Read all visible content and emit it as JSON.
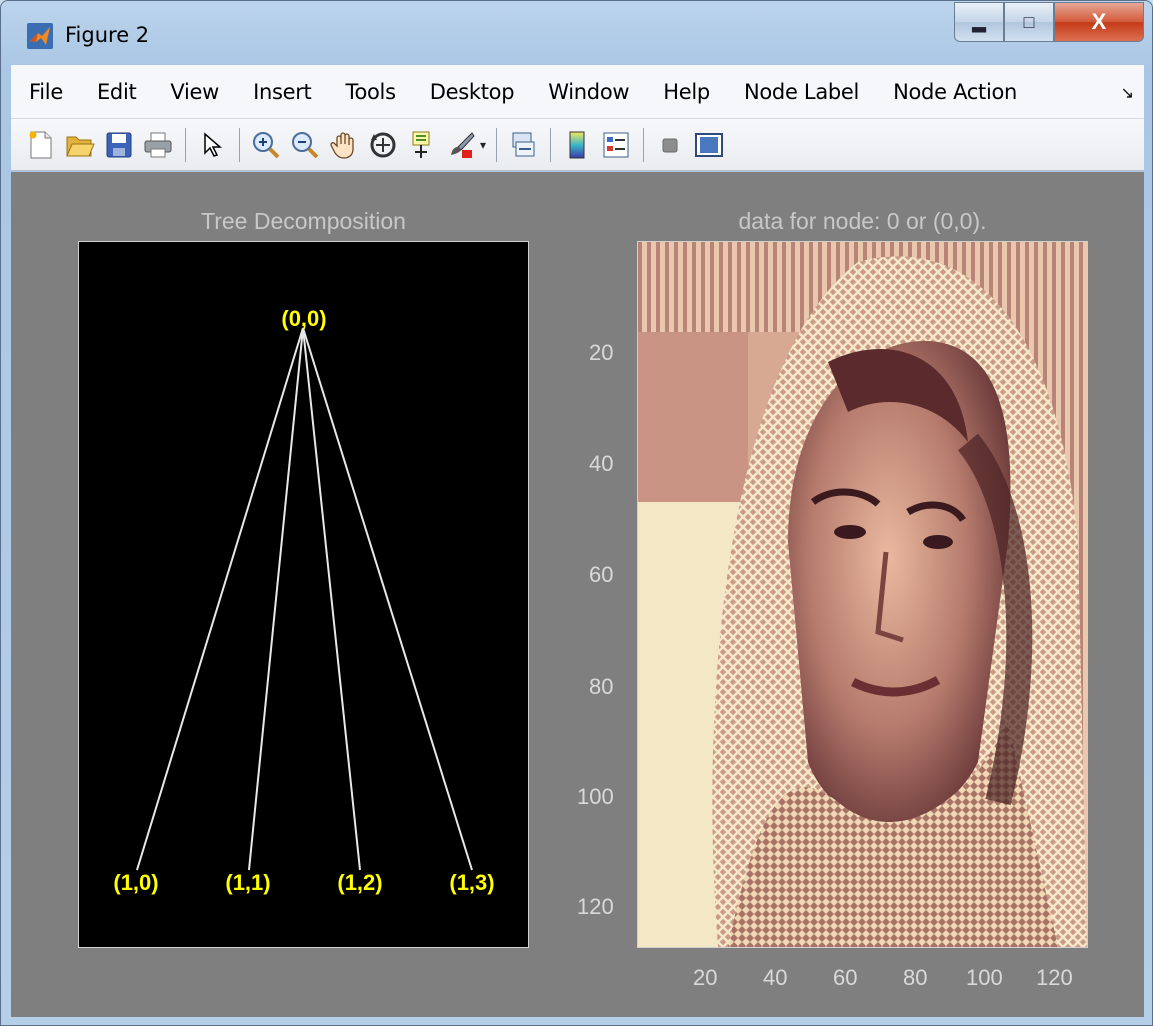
{
  "window": {
    "title": "Figure 2"
  },
  "menu": [
    "File",
    "Edit",
    "View",
    "Insert",
    "Tools",
    "Desktop",
    "Window",
    "Help",
    "Node Label",
    "Node Action"
  ],
  "toolbar_icons": [
    "new-figure-icon",
    "open-file-icon",
    "save-icon",
    "print-icon",
    "edit-plot-arrow-icon",
    "zoom-in-icon",
    "zoom-out-icon",
    "pan-hand-icon",
    "rotate-3d-icon",
    "data-cursor-icon",
    "brush-icon",
    "link-plot-icon",
    "colorbar-icon",
    "legend-icon",
    "hide-plot-tools-icon",
    "show-plot-tools-icon"
  ],
  "tree_panel": {
    "title": "Tree Decomposition",
    "root_label": "(0,0)",
    "children": [
      "(1,0)",
      "(1,1)",
      "(1,2)",
      "(1,3)"
    ]
  },
  "image_panel": {
    "title": "data for node: 0 or (0,0).",
    "y_ticks": [
      "20",
      "40",
      "60",
      "80",
      "100",
      "120"
    ],
    "x_ticks": [
      "20",
      "40",
      "60",
      "80",
      "100",
      "120"
    ]
  },
  "colors": {
    "node_label": "#ffff00",
    "figure_bg": "#7f7f7f",
    "axis_text": "#d9d9d9"
  }
}
